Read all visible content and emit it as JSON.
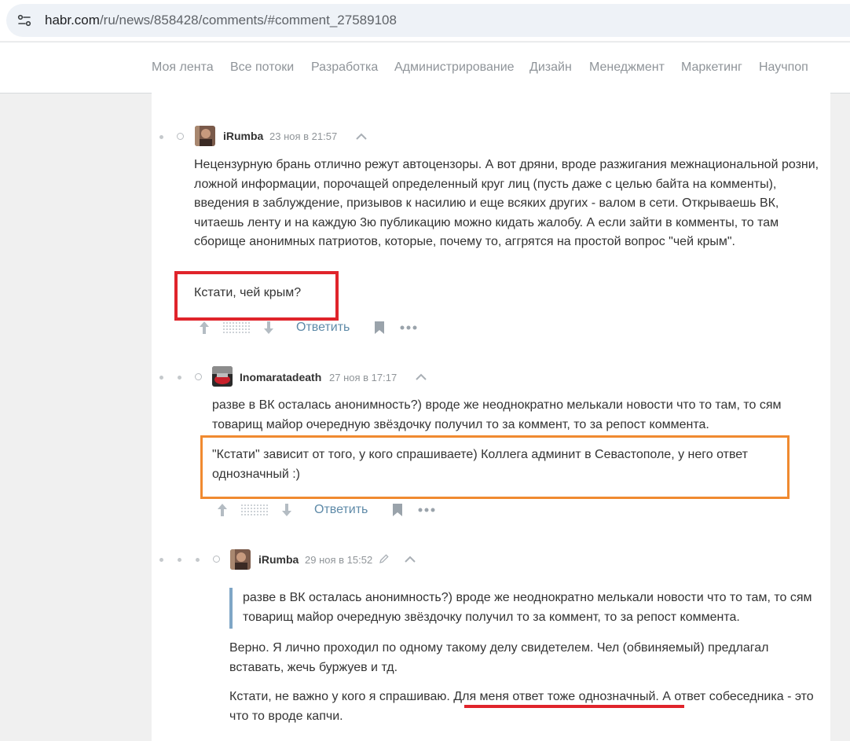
{
  "browser": {
    "url_domain": "habr.com",
    "url_path": "/ru/news/858428/comments/#comment_27589108"
  },
  "nav": {
    "items": [
      "Моя лента",
      "Все потоки",
      "Разработка",
      "Администрирование",
      "Дизайн",
      "Менеджмент",
      "Маркетинг",
      "Научпоп"
    ]
  },
  "comments": [
    {
      "author": "iRumba",
      "date": "23 ноя в 21:57",
      "paragraphs": [
        "Нецензурную брань отлично режут автоцензоры. А вот дряни, вроде разжигания межнациональной розни, ложной информации, порочащей определенный круг лиц (пусть даже с целью байта на комменты), введения в заблуждение, призывов к насилию и еще всяких других - валом в сети. Открываешь ВК, читаешь ленту и на каждую 3ю публикацию можно кидать жалобу. А если зайти в комменты, то там сборище анонимных патриотов, которые, почему то, аггрятся на простой вопрос \"чей крым\".",
        "Кстати, чей крым?"
      ],
      "reply_label": "Ответить"
    },
    {
      "author": "Inomaratadeath",
      "date": "27 ноя в 17:17",
      "paragraphs": [
        "разве в ВК осталась анонимность?) вроде же неоднократно мелькали новости что то там, то сям товарищ майор очередную звёздочку получил то за коммент, то за репост коммента.",
        "\"Кстати\" зависит от того, у кого спрашиваете) Коллега админит в Севастополе, у него ответ однозначный :)"
      ],
      "reply_label": "Ответить"
    },
    {
      "author": "iRumba",
      "date": "29 ноя в 15:52",
      "quote": "разве в ВК осталась анонимность?) вроде же неоднократно мелькали новости что то там, то сям товарищ майор очередную звёздочку получил то за коммент, то за репост коммента.",
      "paragraphs": [
        "Верно. Я лично проходил по одному такому делу свидетелем. Чел (обвиняемый) предлагал вставать, жечь буржуев и тд."
      ],
      "last_paragraph": {
        "before": "Кстати, не важно у кого я спрашиваю. ",
        "highlighted": "Для меня ответ тоже однозначный",
        "after": ". А ответ собеседника - это что то вроде капчи."
      }
    }
  ],
  "colors": {
    "accent_link": "#5e8aa8",
    "highlight_red": "#e0242b",
    "highlight_orange": "#f08a30",
    "quote_bar": "#7fa6c6"
  }
}
